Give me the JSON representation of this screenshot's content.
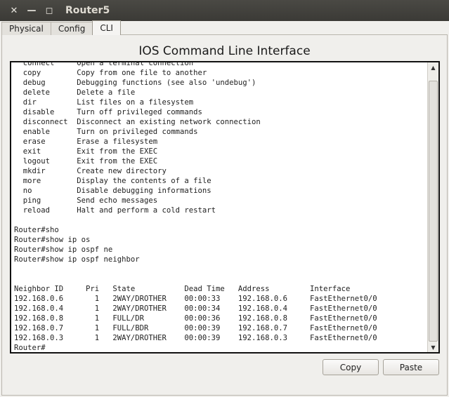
{
  "window": {
    "title": "Router5",
    "close_glyph": "✕",
    "min_glyph": "—",
    "max_glyph": "◻"
  },
  "tabs": [
    {
      "label": "Physical"
    },
    {
      "label": "Config"
    },
    {
      "label": "CLI",
      "active": true
    }
  ],
  "heading": "IOS Command Line Interface",
  "terminal": {
    "lines": [
      "  connect     Open a terminal connection",
      "  copy        Copy from one file to another",
      "  debug       Debugging functions (see also 'undebug')",
      "  delete      Delete a file",
      "  dir         List files on a filesystem",
      "  disable     Turn off privileged commands",
      "  disconnect  Disconnect an existing network connection",
      "  enable      Turn on privileged commands",
      "  erase       Erase a filesystem",
      "  exit        Exit from the EXEC",
      "  logout      Exit from the EXEC",
      "  mkdir       Create new directory",
      "  more        Display the contents of a file",
      "  no          Disable debugging informations",
      "  ping        Send echo messages",
      "  reload      Halt and perform a cold restart",
      "",
      "Router#sho",
      "Router#show ip os",
      "Router#show ip ospf ne",
      "Router#show ip ospf neighbor",
      "",
      "",
      "Neighbor ID     Pri   State           Dead Time   Address         Interface",
      "192.168.0.6       1   2WAY/DROTHER    00:00:33    192.168.0.6     FastEthernet0/0",
      "192.168.0.4       1   2WAY/DROTHER    00:00:34    192.168.0.4     FastEthernet0/0",
      "192.168.0.8       1   FULL/DR         00:00:36    192.168.0.8     FastEthernet0/0",
      "192.168.0.7       1   FULL/BDR        00:00:39    192.168.0.7     FastEthernet0/0",
      "192.168.0.3       1   2WAY/DROTHER    00:00:39    192.168.0.3     FastEthernet0/0",
      "Router#"
    ],
    "scroll_position": 0.95,
    "scroll_up_glyph": "▲",
    "scroll_down_glyph": "▼"
  },
  "buttons": {
    "copy": "Copy",
    "paste": "Paste"
  }
}
